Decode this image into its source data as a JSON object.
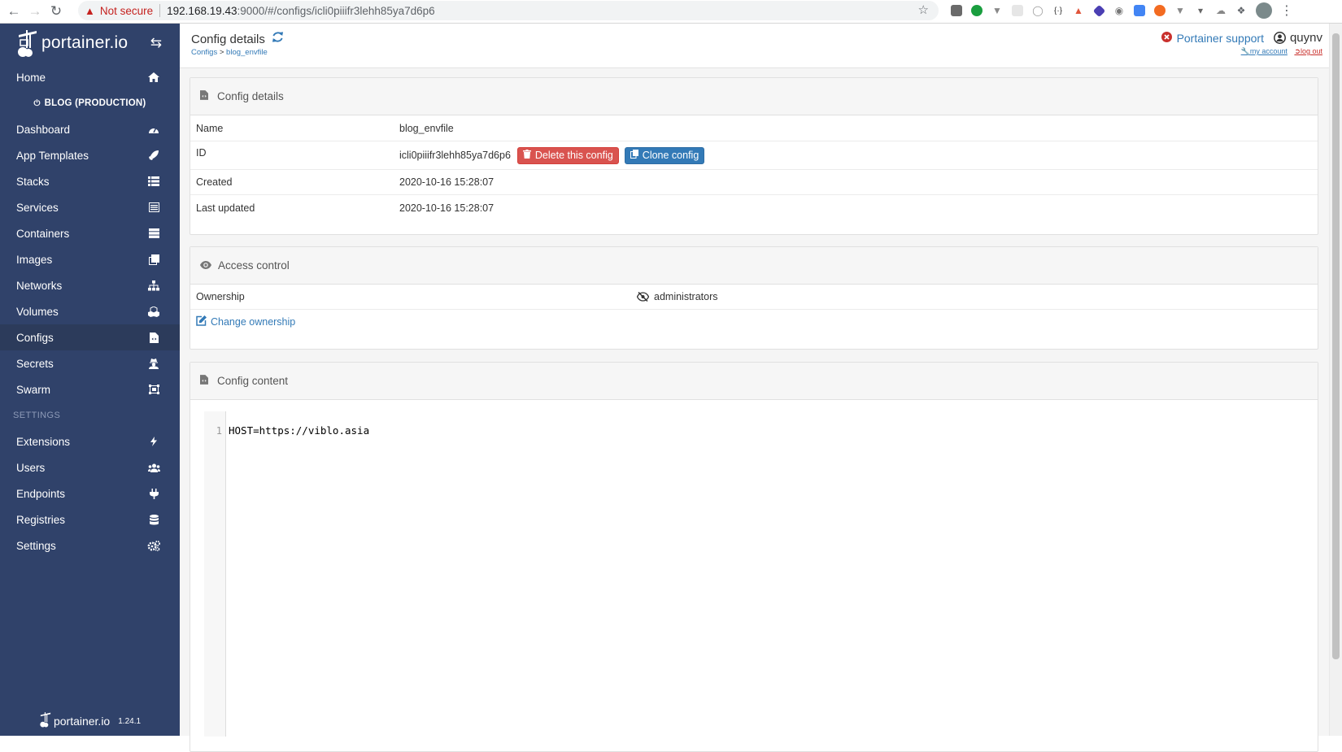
{
  "browser": {
    "warning_label": "Not secure",
    "url_host": "192.168.19.43",
    "url_path": ":9000/#/configs/icli0piiifr3lehh85ya7d6p6"
  },
  "sidebar": {
    "logo_text": "portainer.io",
    "endpoint": "BLOG (PRODUCTION)",
    "items": [
      {
        "label": "Home",
        "icon": "home-icon"
      },
      {
        "label": "Dashboard",
        "icon": "dashboard-icon"
      },
      {
        "label": "App Templates",
        "icon": "rocket-icon"
      },
      {
        "label": "Stacks",
        "icon": "th-list-icon"
      },
      {
        "label": "Services",
        "icon": "list-alt-icon"
      },
      {
        "label": "Containers",
        "icon": "server-icon"
      },
      {
        "label": "Images",
        "icon": "clone-icon"
      },
      {
        "label": "Networks",
        "icon": "sitemap-icon"
      },
      {
        "label": "Volumes",
        "icon": "cubes-icon"
      },
      {
        "label": "Configs",
        "icon": "file-code-icon"
      },
      {
        "label": "Secrets",
        "icon": "user-secret-icon"
      },
      {
        "label": "Swarm",
        "icon": "object-group-icon"
      }
    ],
    "settings_heading": "SETTINGS",
    "settings_items": [
      {
        "label": "Extensions",
        "icon": "bolt-icon"
      },
      {
        "label": "Users",
        "icon": "users-icon"
      },
      {
        "label": "Endpoints",
        "icon": "plug-icon"
      },
      {
        "label": "Registries",
        "icon": "database-icon"
      },
      {
        "label": "Settings",
        "icon": "cogs-icon"
      }
    ],
    "footer_logo": "portainer.io",
    "footer_version": "1.24.1",
    "active": "Configs"
  },
  "header": {
    "title": "Config details",
    "breadcrumb_link": "Configs",
    "breadcrumb_sep": " > ",
    "breadcrumb_current": "blog_envfile",
    "support_label": "Portainer support",
    "username": "quynv",
    "my_account": "my account",
    "log_out": "log out"
  },
  "config_details": {
    "heading": "Config details",
    "name_label": "Name",
    "name_value": "blog_envfile",
    "id_label": "ID",
    "id_value": "icli0piiifr3lehh85ya7d6p6",
    "delete_label": "Delete this config",
    "clone_label": "Clone config",
    "created_label": "Created",
    "created_value": "2020-10-16 15:28:07",
    "updated_label": "Last updated",
    "updated_value": "2020-10-16 15:28:07"
  },
  "access_control": {
    "heading": "Access control",
    "ownership_label": "Ownership",
    "ownership_value": "administrators",
    "change_label": "Change ownership"
  },
  "config_content": {
    "heading": "Config content",
    "line_number": "1",
    "line": "HOST=https://viblo.asia"
  }
}
